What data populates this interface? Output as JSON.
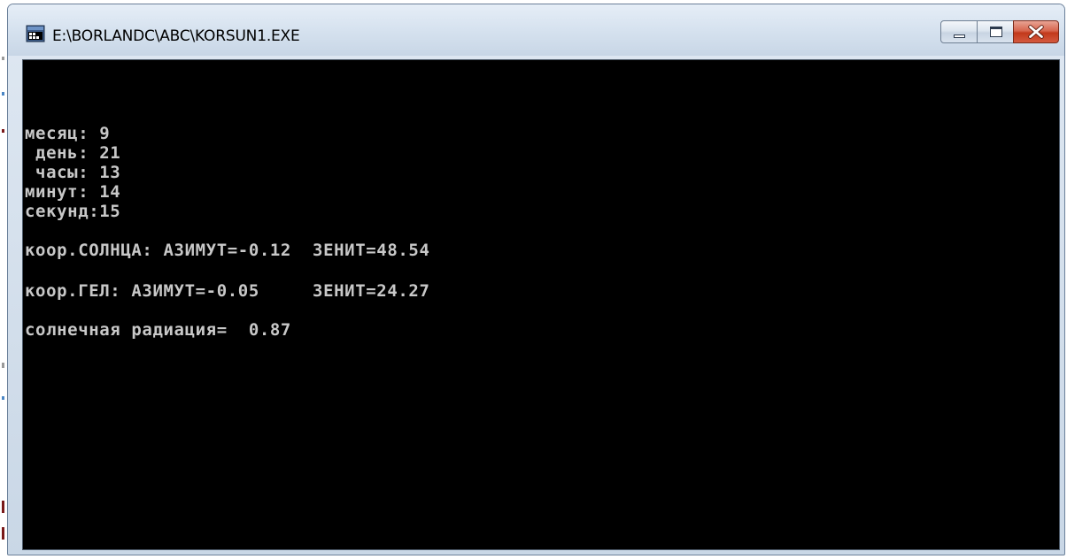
{
  "window": {
    "title": "E:\\BORLANDC\\ABC\\KORSUN1.EXE",
    "icon": "console-app-icon"
  },
  "caption_buttons": {
    "minimize": "minimize-icon",
    "maximize": "maximize-icon",
    "close": "close-icon"
  },
  "console": {
    "lines": [
      "месяц: 9",
      " день: 21",
      " часы: 13",
      "минут: 14",
      "секунд:15",
      "коор.СОЛНЦА: АЗИМУТ=-0.12  ЗЕНИТ=48.54",
      "коор.ГЕЛ: АЗИМУТ=-0.05     ЗЕНИТ=24.27",
      "солнечная радиация=  0.87"
    ]
  },
  "colors": {
    "console_bg": "#000000",
    "console_text": "#c8c8c8",
    "close_button": "#c2391b",
    "titlebar": "#d6e2ef"
  }
}
